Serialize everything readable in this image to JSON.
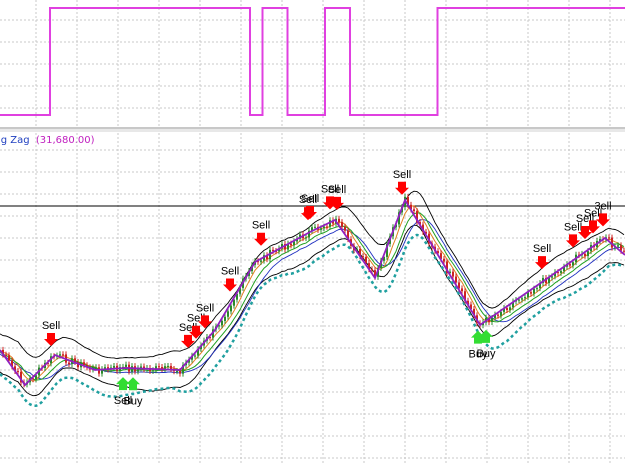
{
  "indicator_label": {
    "name": "ig Zag",
    "value": "(31,680.00)"
  },
  "colors": {
    "background": "#ffffff",
    "grid": "#c8c8c8",
    "upper_signal_line": "#e040e0",
    "zigzag": "#9020c0",
    "candles_up": "#2a8a2a",
    "candles_down": "#cc2222",
    "bands": "#000000",
    "dotted_band": "#20a0a0",
    "ma_blue": "#2030c0",
    "ma_orange": "#e08020",
    "ma_green": "#20a020",
    "sell_arrow": "#ff0000",
    "buy_arrow": "#33dd33",
    "indicator_name": "#2040c0",
    "indicator_value": "#c020c0"
  },
  "chart_data": [
    {
      "type": "line",
      "panel": "upper",
      "series": [
        {
          "values": [
            0,
            0,
            0,
            0,
            1,
            1,
            1,
            1,
            1,
            1,
            1,
            1,
            1,
            1,
            1,
            1,
            1,
            1,
            1,
            1,
            0,
            1,
            1,
            0,
            0,
            0,
            1,
            1,
            0,
            0,
            0,
            0,
            0,
            0,
            0,
            1,
            1,
            1,
            1,
            1,
            1,
            1,
            1,
            1,
            1,
            1,
            1,
            1,
            1,
            1
          ]
        }
      ]
    },
    {
      "type": "line",
      "panel": "lower",
      "zigzag": {
        "x": [
          0,
          25,
          55,
          95,
          125,
          180,
          215,
          255,
          310,
          335,
          375,
          405,
          480,
          545,
          605,
          625
        ],
        "y": [
          350,
          385,
          355,
          370,
          368,
          370,
          330,
          262,
          232,
          220,
          278,
          200,
          325,
          280,
          238,
          255
        ]
      },
      "signals": [
        {
          "kind": "sell",
          "label": "Sell",
          "x": 51
        },
        {
          "kind": "buy",
          "label": "Sell",
          "x": 123
        },
        {
          "kind": "buy",
          "label": "Buy",
          "x": 133
        },
        {
          "kind": "sell",
          "label": "Sell",
          "x": 188
        },
        {
          "kind": "sell",
          "label": "Sell",
          "x": 196
        },
        {
          "kind": "sell",
          "label": "Sell",
          "x": 205
        },
        {
          "kind": "sell",
          "label": "Sell",
          "x": 230
        },
        {
          "kind": "sell",
          "label": "Sell",
          "x": 261
        },
        {
          "kind": "sell",
          "label": "Sell",
          "x": 308
        },
        {
          "kind": "sell",
          "label": "Sell",
          "x": 310
        },
        {
          "kind": "sell",
          "label": "Sell",
          "x": 330
        },
        {
          "kind": "sell",
          "label": "Sell",
          "x": 337
        },
        {
          "kind": "sell",
          "label": "Sell",
          "x": 402
        },
        {
          "kind": "buy",
          "label": "Buy",
          "x": 478
        },
        {
          "kind": "buy",
          "label": "Buy",
          "x": 486
        },
        {
          "kind": "sell",
          "label": "Sell",
          "x": 542
        },
        {
          "kind": "sell",
          "label": "Sell",
          "x": 573
        },
        {
          "kind": "sell",
          "label": "Sell",
          "x": 585
        },
        {
          "kind": "sell",
          "label": "Sell",
          "x": 593
        },
        {
          "kind": "sell",
          "label": "3ell",
          "x": 603
        }
      ]
    }
  ]
}
